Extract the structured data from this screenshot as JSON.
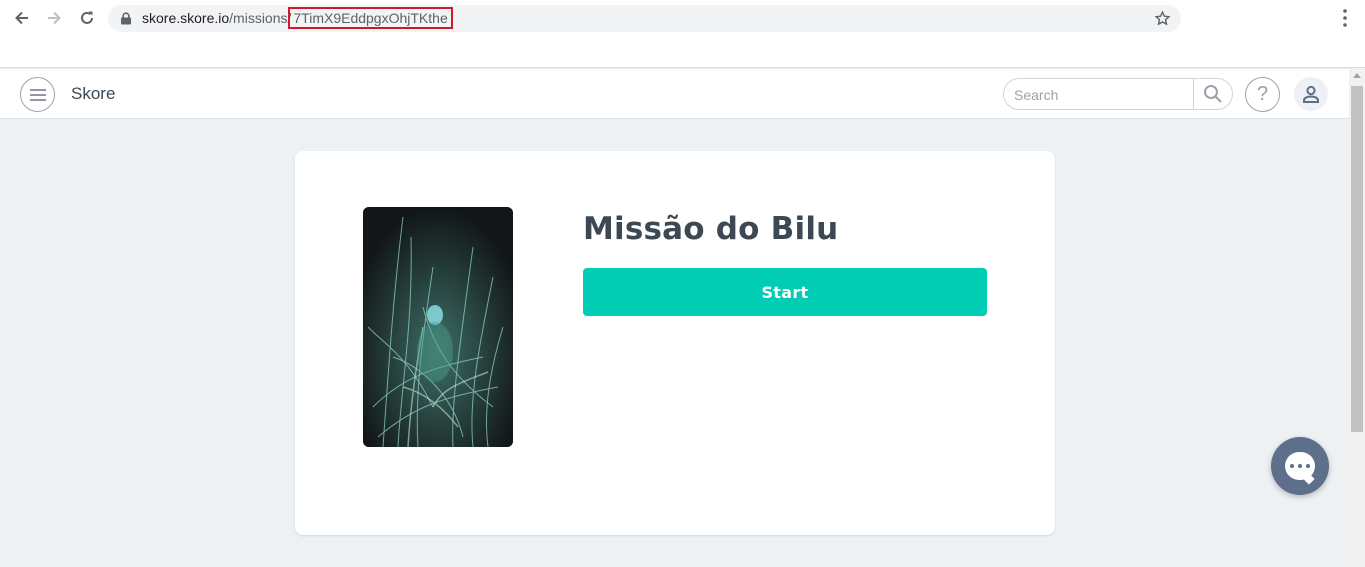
{
  "browser": {
    "url_host": "skore.skore.io",
    "url_path": "/missions/",
    "url_id": "7TimX9EddpgxOhjTKthe"
  },
  "header": {
    "brand": "Skore",
    "search_placeholder": "Search",
    "help_label": "?"
  },
  "mission": {
    "title": "Missão do Bilu",
    "start_label": "Start"
  },
  "colors": {
    "accent": "#00cdb4",
    "text": "#3d4852",
    "chat": "#5d6f8a",
    "url_highlight": "#d0182a"
  }
}
